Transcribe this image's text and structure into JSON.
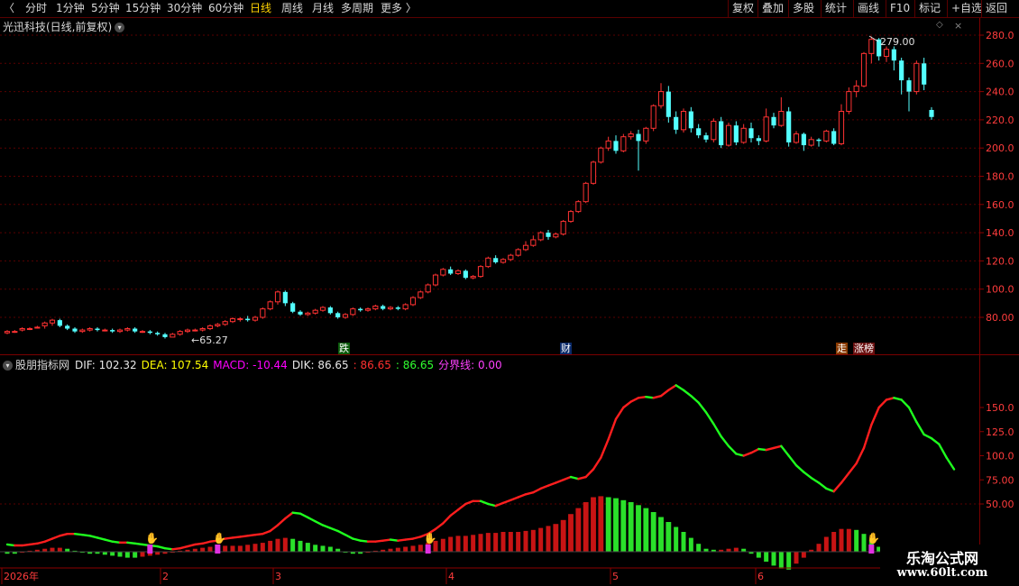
{
  "toolbar": {
    "back_glyph": "〈",
    "periods": [
      "分时",
      "1分钟",
      "5分钟",
      "15分钟",
      "30分钟",
      "60分钟",
      "日线",
      "周线",
      "月线",
      "多周期",
      "更多 〉"
    ],
    "active_period": "日线",
    "actions": [
      "复权",
      "叠加",
      "多股",
      "统计",
      "画线",
      "F10",
      "标记",
      "+自选",
      "返回"
    ]
  },
  "main_pane": {
    "title": "光迅科技(日线,前复权)",
    "high_label": "279.00",
    "low_label": "←65.27",
    "event_tags": [
      {
        "text": "跌",
        "bg": "#0a5a0a",
        "color": "#ffffff"
      },
      {
        "text": "财",
        "bg": "#0a2a6a",
        "color": "#ffffff"
      },
      {
        "text": "走",
        "bg": "#8a3a00",
        "color": "#ffffff"
      },
      {
        "text": "涨榜",
        "bg": "#6a1010",
        "color": "#ffffff"
      }
    ],
    "y_ticks": [
      "280.0",
      "260.0",
      "240.0",
      "220.0",
      "200.0",
      "180.0",
      "160.0",
      "140.0",
      "120.0",
      "100.0",
      "80.00"
    ]
  },
  "indicator_pane": {
    "name": "股朋指标网",
    "legend": [
      {
        "text": "DIF: 102.32",
        "color": "#e8e8e8"
      },
      {
        "text": "DEA: 107.54",
        "color": "#ffff00"
      },
      {
        "text": "MACD: -10.44",
        "color": "#ff00ff"
      },
      {
        "text": "DIK: 86.65",
        "color": "#e8e8e8"
      },
      {
        "text": ": 86.65",
        "color": "#ff3030"
      },
      {
        "text": ": 86.65",
        "color": "#30ff30"
      },
      {
        "text": "分界线: 0.00",
        "color": "#ff40ff"
      }
    ],
    "y_ticks": [
      "150.0",
      "125.0",
      "100.0",
      "75.00",
      "50.00"
    ]
  },
  "x_axis": {
    "labels": [
      "2026年",
      "2",
      "3",
      "4",
      "5",
      "6"
    ]
  },
  "watermark": {
    "line1": "乐淘公式网",
    "line2": "www.60lt.com"
  },
  "colors": {
    "up": "#ff3232",
    "down": "#54ffff",
    "grid": "#5a0000",
    "axis": "#8b0000",
    "tick_text": "#ff3c3c"
  },
  "chart_data": [
    {
      "type": "candlestick",
      "title": "光迅科技(日线,前复权)",
      "ylim": [
        60,
        290
      ],
      "annotations": [
        {
          "text": "279.00"
        },
        {
          "text": "←65.27"
        }
      ],
      "candles": [
        [
          69,
          70,
          68,
          71
        ],
        [
          70,
          70,
          69,
          71
        ],
        [
          71,
          72,
          70,
          73
        ],
        [
          72,
          72,
          71,
          73
        ],
        [
          73,
          73,
          72,
          74
        ],
        [
          74,
          76,
          72,
          77
        ],
        [
          76,
          78,
          74,
          79
        ],
        [
          78,
          74,
          73,
          79
        ],
        [
          74,
          72,
          71,
          75
        ],
        [
          72,
          70,
          69,
          73
        ],
        [
          70,
          71,
          69,
          72
        ],
        [
          71,
          72,
          70,
          73
        ],
        [
          72,
          71,
          70,
          73
        ],
        [
          71,
          71,
          70,
          72
        ],
        [
          71,
          70,
          69,
          72
        ],
        [
          70,
          71,
          69,
          72
        ],
        [
          71,
          72,
          70,
          73
        ],
        [
          72,
          70,
          69,
          73
        ],
        [
          70,
          70,
          69,
          71
        ],
        [
          70,
          69,
          68,
          71
        ],
        [
          69,
          68,
          67,
          70
        ],
        [
          68,
          66,
          65,
          69
        ],
        [
          66,
          68,
          66,
          69
        ],
        [
          68,
          70,
          67,
          71
        ],
        [
          70,
          71,
          69,
          72
        ],
        [
          71,
          71,
          70,
          72
        ],
        [
          71,
          72,
          70,
          73
        ],
        [
          72,
          74,
          71,
          75
        ],
        [
          74,
          75,
          73,
          76
        ],
        [
          75,
          77,
          74,
          78
        ],
        [
          77,
          79,
          76,
          80
        ],
        [
          79,
          79,
          77,
          80
        ],
        [
          79,
          78,
          77,
          81
        ],
        [
          78,
          80,
          77,
          81
        ],
        [
          80,
          86,
          79,
          87
        ],
        [
          86,
          91,
          85,
          92
        ],
        [
          91,
          98,
          89,
          99
        ],
        [
          98,
          90,
          88,
          99
        ],
        [
          90,
          84,
          83,
          91
        ],
        [
          84,
          82,
          81,
          85
        ],
        [
          82,
          83,
          81,
          84
        ],
        [
          83,
          85,
          82,
          86
        ],
        [
          85,
          87,
          84,
          88
        ],
        [
          87,
          83,
          82,
          88
        ],
        [
          83,
          80,
          79,
          84
        ],
        [
          80,
          82,
          79,
          83
        ],
        [
          82,
          86,
          81,
          87
        ],
        [
          86,
          85,
          84,
          87
        ],
        [
          85,
          86,
          84,
          87
        ],
        [
          86,
          88,
          85,
          89
        ],
        [
          88,
          86,
          85,
          89
        ],
        [
          86,
          87,
          85,
          88
        ],
        [
          87,
          86,
          85,
          88
        ],
        [
          86,
          89,
          85,
          90
        ],
        [
          89,
          94,
          88,
          95
        ],
        [
          94,
          98,
          93,
          99
        ],
        [
          98,
          103,
          97,
          104
        ],
        [
          103,
          110,
          102,
          111
        ],
        [
          110,
          114,
          109,
          115
        ],
        [
          114,
          111,
          110,
          116
        ],
        [
          111,
          113,
          110,
          114
        ],
        [
          113,
          108,
          107,
          114
        ],
        [
          108,
          109,
          107,
          110
        ],
        [
          109,
          116,
          108,
          117
        ],
        [
          116,
          122,
          115,
          123
        ],
        [
          122,
          119,
          118,
          124
        ],
        [
          119,
          121,
          118,
          122
        ],
        [
          121,
          124,
          120,
          125
        ],
        [
          124,
          128,
          123,
          129
        ],
        [
          128,
          131,
          127,
          134
        ],
        [
          131,
          135,
          130,
          138
        ],
        [
          135,
          140,
          134,
          141
        ],
        [
          140,
          137,
          135,
          142
        ],
        [
          137,
          139,
          136,
          140
        ],
        [
          139,
          148,
          138,
          149
        ],
        [
          148,
          155,
          147,
          156
        ],
        [
          155,
          162,
          154,
          163
        ],
        [
          162,
          175,
          161,
          176
        ],
        [
          175,
          190,
          174,
          191
        ],
        [
          190,
          200,
          189,
          201
        ],
        [
          200,
          205,
          198,
          208
        ],
        [
          205,
          198,
          196,
          209
        ],
        [
          198,
          208,
          197,
          210
        ],
        [
          208,
          210,
          206,
          212
        ],
        [
          210,
          205,
          184,
          213
        ],
        [
          205,
          214,
          203,
          215
        ],
        [
          214,
          230,
          212,
          231
        ],
        [
          230,
          240,
          228,
          246
        ],
        [
          240,
          222,
          218,
          244
        ],
        [
          222,
          213,
          210,
          226
        ],
        [
          213,
          226,
          211,
          228
        ],
        [
          226,
          214,
          211,
          229
        ],
        [
          214,
          209,
          207,
          217
        ],
        [
          209,
          206,
          204,
          211
        ],
        [
          206,
          219,
          204,
          221
        ],
        [
          219,
          202,
          200,
          222
        ],
        [
          202,
          216,
          201,
          218
        ],
        [
          216,
          204,
          202,
          219
        ],
        [
          204,
          214,
          203,
          217
        ],
        [
          214,
          207,
          204,
          218
        ],
        [
          207,
          205,
          202,
          209
        ],
        [
          205,
          222,
          204,
          228
        ],
        [
          222,
          216,
          214,
          225
        ],
        [
          216,
          226,
          215,
          236
        ],
        [
          226,
          204,
          201,
          229
        ],
        [
          204,
          210,
          203,
          212
        ],
        [
          210,
          202,
          198,
          211
        ],
        [
          202,
          206,
          201,
          208
        ],
        [
          206,
          205,
          201,
          207
        ],
        [
          205,
          212,
          204,
          213
        ],
        [
          212,
          203,
          202,
          214
        ],
        [
          203,
          226,
          202,
          231
        ],
        [
          226,
          240,
          224,
          243
        ],
        [
          240,
          244,
          236,
          248
        ],
        [
          244,
          267,
          243,
          268
        ],
        [
          267,
          277,
          260,
          279
        ],
        [
          277,
          265,
          262,
          278
        ],
        [
          265,
          270,
          261,
          272
        ],
        [
          270,
          262,
          255,
          272
        ],
        [
          262,
          248,
          238,
          264
        ],
        [
          248,
          240,
          226,
          250
        ],
        [
          240,
          260,
          238,
          262
        ],
        [
          260,
          245,
          241,
          264
        ],
        [
          227,
          222,
          220,
          229
        ]
      ]
    },
    {
      "type": "line",
      "title": "股朋指标网",
      "ylim": [
        0,
        175
      ],
      "series": [
        {
          "name": "DIK",
          "values": [
            8,
            7,
            7,
            8,
            9,
            11,
            14,
            17,
            19,
            19,
            18,
            17,
            15,
            13,
            11,
            10,
            10,
            9,
            8,
            7,
            6,
            4,
            3,
            4,
            6,
            8,
            9,
            11,
            12,
            14,
            15,
            16,
            17,
            18,
            19,
            22,
            28,
            35,
            41,
            40,
            36,
            32,
            28,
            25,
            22,
            18,
            14,
            12,
            11,
            11,
            12,
            13,
            12,
            13,
            14,
            16,
            19,
            24,
            30,
            38,
            44,
            50,
            53,
            53,
            50,
            48,
            51,
            54,
            57,
            60,
            62,
            66,
            69,
            72,
            75,
            78,
            76,
            78,
            86,
            98,
            117,
            138,
            150,
            156,
            160,
            161,
            160,
            162,
            168,
            173,
            168,
            162,
            155,
            145,
            133,
            120,
            110,
            102,
            100,
            103,
            107,
            106,
            108,
            110,
            100,
            90,
            83,
            77,
            72,
            66,
            63,
            72,
            82,
            92,
            108,
            132,
            150,
            158,
            160,
            158,
            150,
            135,
            122,
            118,
            112,
            98,
            86
          ]
        }
      ],
      "macd_bars": [
        -2,
        -2,
        -1,
        1,
        2,
        3,
        4,
        4,
        3,
        1,
        -1,
        -2,
        -2,
        -3,
        -4,
        -5,
        -6,
        -6,
        -5,
        -4,
        -3,
        -2,
        -1,
        1,
        2,
        3,
        4,
        5,
        5,
        6,
        6,
        6,
        7,
        8,
        9,
        11,
        13,
        14,
        13,
        11,
        9,
        7,
        6,
        5,
        3,
        -1,
        -2,
        -2,
        -1,
        1,
        2,
        3,
        4,
        5,
        6,
        7,
        9,
        11,
        13,
        15,
        16,
        16,
        17,
        18,
        19,
        19,
        20,
        20,
        20,
        21,
        22,
        24,
        26,
        28,
        32,
        38,
        44,
        50,
        55,
        56,
        55,
        54,
        52,
        50,
        47,
        44,
        40,
        35,
        30,
        25,
        20,
        14,
        8,
        3,
        2,
        2,
        3,
        4,
        3,
        -2,
        -6,
        -10,
        -14,
        -17,
        -18,
        -12,
        -6,
        2,
        8,
        15,
        20,
        23,
        23,
        22,
        18,
        12,
        5,
        0
      ]
    }
  ]
}
